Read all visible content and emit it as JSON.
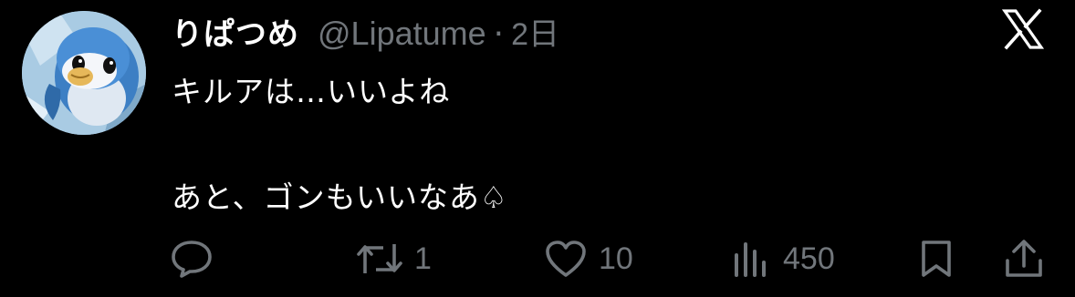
{
  "tweet": {
    "display_name": "りぱつめ",
    "handle": "@Lipatume",
    "separator": "·",
    "timestamp": "2日",
    "text_line1": "キルアは…いいよね",
    "text_line2": "あと、ゴンもいいなあ♤"
  },
  "actions": {
    "reply": {
      "icon": "reply-icon",
      "count": ""
    },
    "retweet": {
      "icon": "retweet-icon",
      "count": "1"
    },
    "like": {
      "icon": "heart-icon",
      "count": "10"
    },
    "views": {
      "icon": "views-icon",
      "count": "450"
    },
    "bookmark": {
      "icon": "bookmark-icon"
    },
    "share": {
      "icon": "share-icon"
    }
  },
  "platform": {
    "logo": "x-logo-icon"
  },
  "colors": {
    "background": "#000000",
    "primary_text": "#ffffff",
    "secondary_text": "#71767b"
  }
}
